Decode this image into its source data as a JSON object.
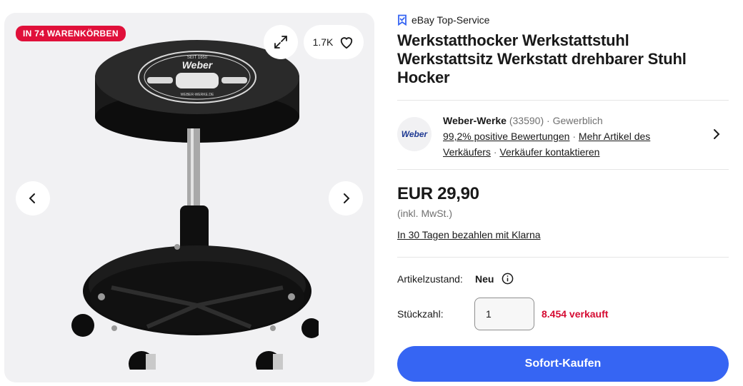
{
  "gallery": {
    "badge": "IN 74 WARENKÖRBEN",
    "watch_count": "1.7K",
    "logo_text": "Weber",
    "logo_since": "SEIT 1950",
    "logo_url": "WEBER-WERKE.DE"
  },
  "product": {
    "top_service": "eBay Top-Service",
    "title_line1": "Werkstatthocker Werkstattstuhl",
    "title_line2": "Werkstattsitz Werkstatt drehbarer Stuhl",
    "title_line3": "Hocker"
  },
  "seller": {
    "logo_text": "Weber",
    "name": "Weber-Werke",
    "feedback_count": "(33590)",
    "type": "Gewerblich",
    "sep": "·",
    "positive": "99,2% positive Bewertungen",
    "more_items_1": "Mehr Artikel des",
    "more_items_2": "Verkäufers",
    "contact": "Verkäufer kontaktieren"
  },
  "pricing": {
    "price": "EUR 29,90",
    "tax": "(inkl. MwSt.)",
    "klarna": "In 30 Tagen bezahlen mit Klarna"
  },
  "condition": {
    "label": "Artikelzustand:",
    "value": "Neu"
  },
  "quantity": {
    "label": "Stückzahl:",
    "value": "1",
    "sold": "8.454 verkauft"
  },
  "buy_now": "Sofort-Kaufen"
}
